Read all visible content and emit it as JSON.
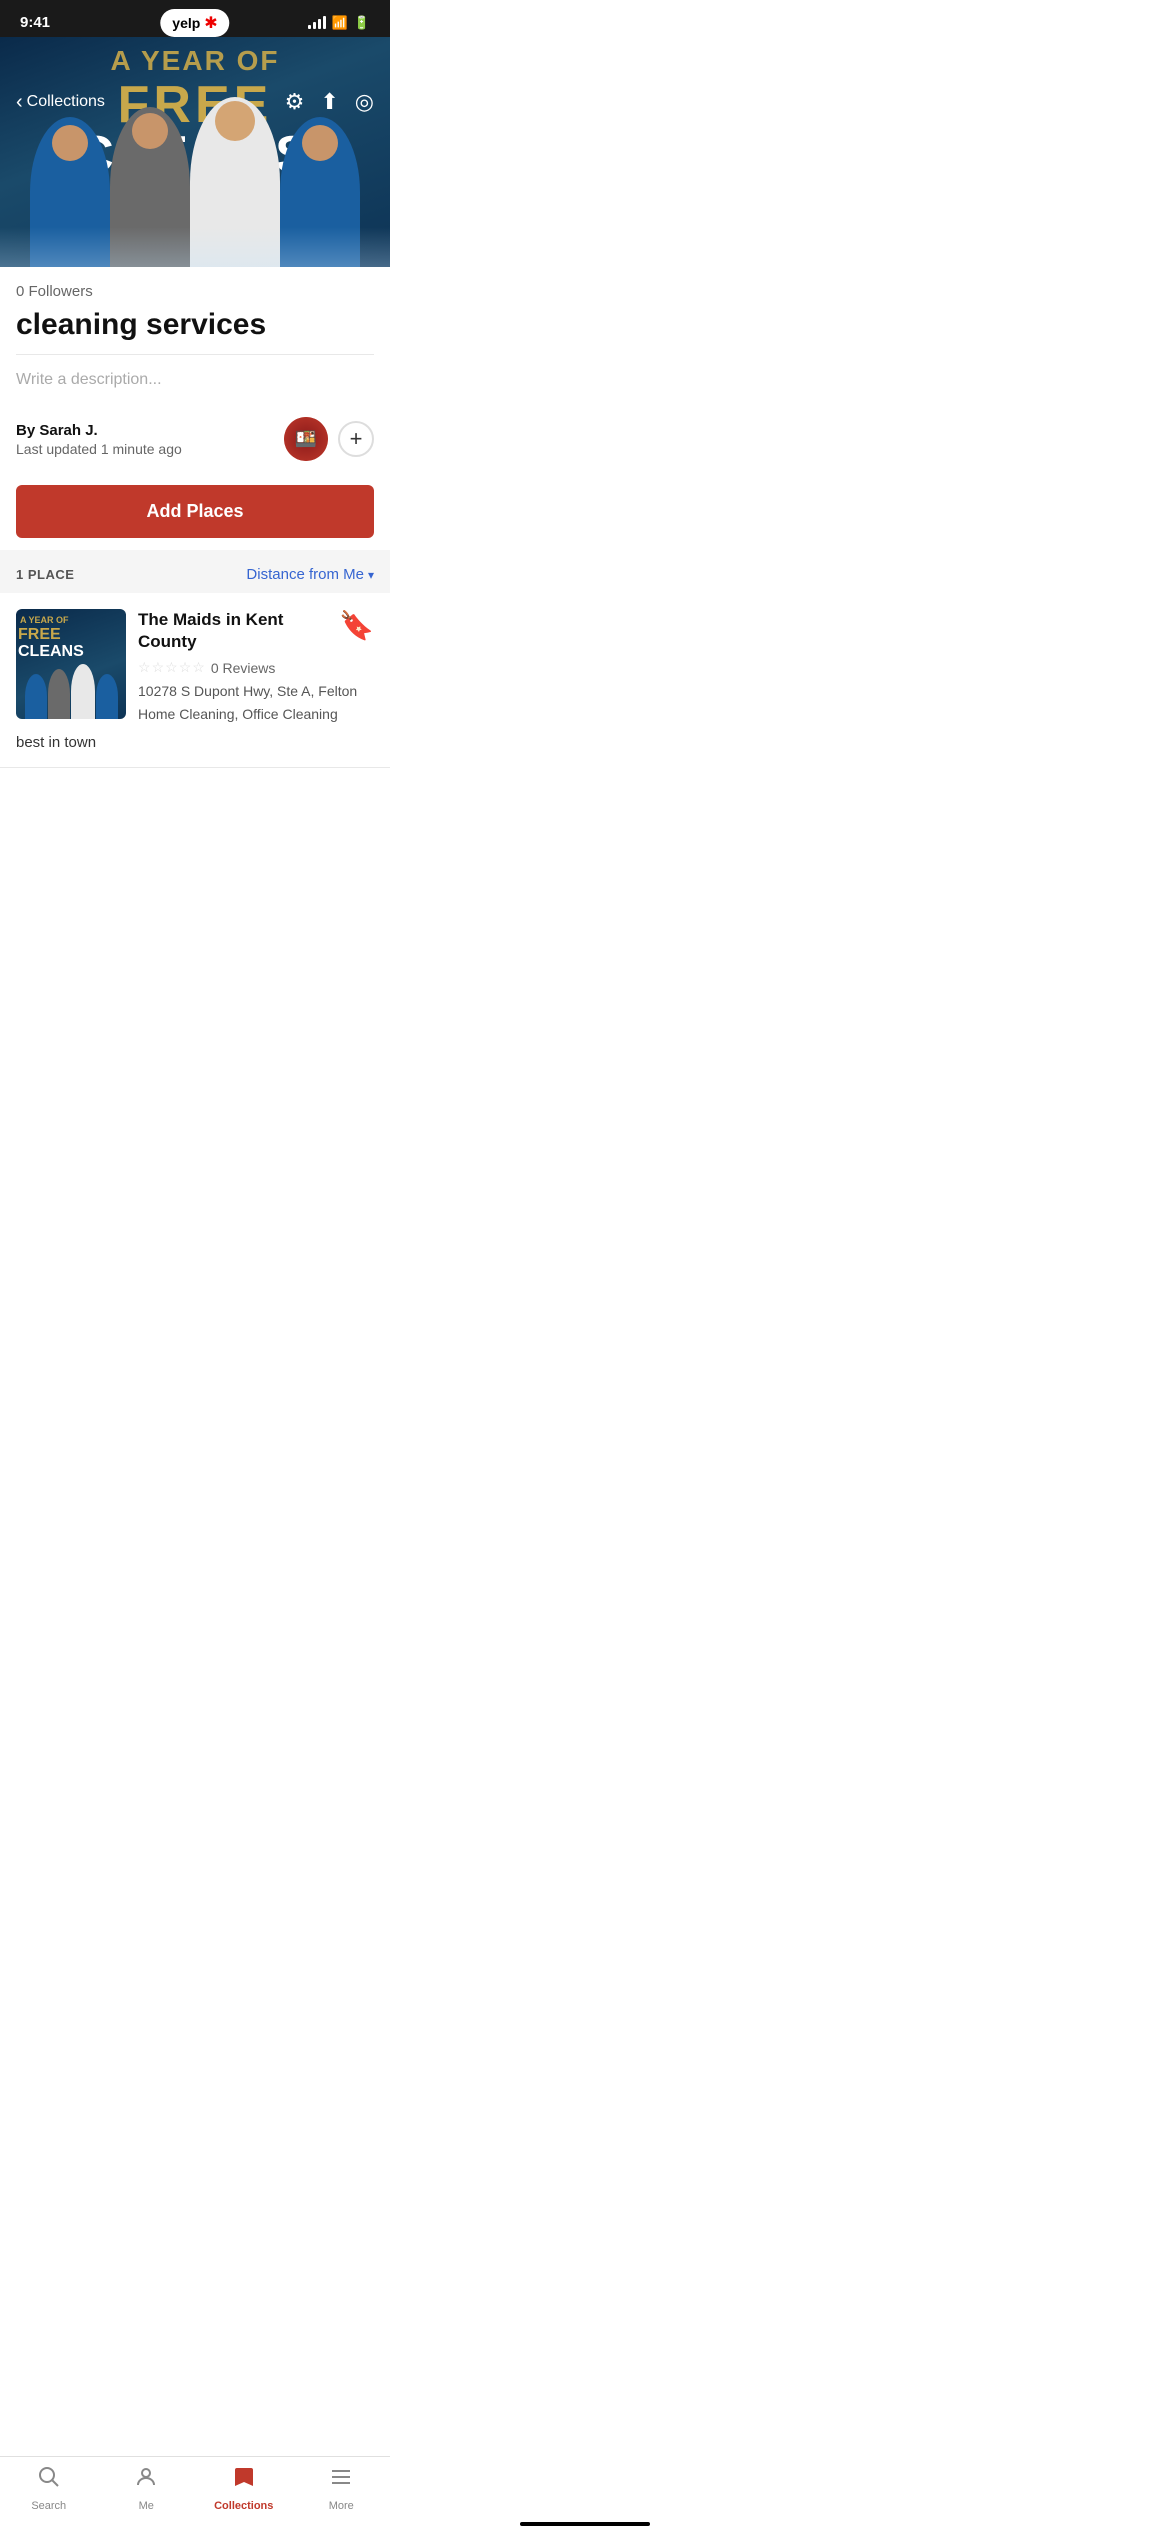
{
  "statusBar": {
    "time": "9:41",
    "yelpLogoText": "yelp",
    "yelpBurst": "✱"
  },
  "navBar": {
    "backLabel": "Collections",
    "backArrow": "‹"
  },
  "hero": {
    "line1": "A YEAR OF",
    "line2": "FREE",
    "line3": "CLEANS"
  },
  "collection": {
    "followers": "0 Followers",
    "title": "cleaning services",
    "descriptionPlaceholder": "Write a description...",
    "authorPrefix": "By",
    "authorName": "Sarah J.",
    "lastUpdated": "Last updated 1 minute ago",
    "addPlacesLabel": "Add Places",
    "placeCount": "1 PLACE",
    "sortLabel": "Distance from Me",
    "sortChevron": "▾"
  },
  "place": {
    "name": "The Maids in Kent County",
    "reviews": "0 Reviews",
    "address": "10278 S Dupont Hwy, Ste A, Felton",
    "categories": "Home Cleaning, Office Cleaning",
    "note": "best in town",
    "stars": [
      "☆",
      "☆",
      "☆",
      "☆",
      "☆"
    ]
  },
  "tabBar": {
    "tabs": [
      {
        "id": "search",
        "icon": "⊕",
        "label": "Search",
        "active": false
      },
      {
        "id": "me",
        "icon": "⊙",
        "label": "Me",
        "active": false
      },
      {
        "id": "collections",
        "icon": "🔖",
        "label": "Collections",
        "active": true
      },
      {
        "id": "more",
        "icon": "≡",
        "label": "More",
        "active": false
      }
    ]
  },
  "icons": {
    "settingsIcon": "⚙",
    "shareIcon": "⬆",
    "locationIcon": "◎",
    "plusIcon": "+"
  }
}
